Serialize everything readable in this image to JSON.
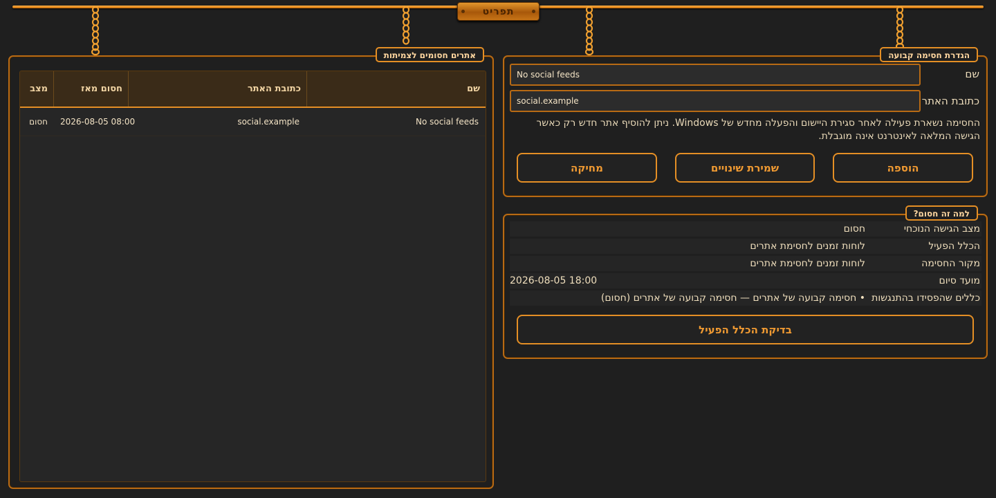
{
  "menu": {
    "label": "תפריט"
  },
  "blocked_list": {
    "title": "אתרים חסומים לצמיתות",
    "columns": {
      "name": "שם",
      "url": "כתובת האתר",
      "since": "חסום מאז",
      "status": "מצב"
    },
    "rows": [
      {
        "name": "No social feeds",
        "url": "social.example",
        "since": "2026-08-05 08:00",
        "status": "חסום"
      }
    ]
  },
  "form": {
    "title": "הגדרת חסימה קבועה",
    "name_label": "שם",
    "name_value": "No social feeds",
    "url_label": "כתובת האתר",
    "url_value": "social.example",
    "note": "החסימה נשארת פעילה לאחר סגירת היישום והפעלה מחדש של Windows. ניתן להוסיף אתר חדש רק כאשר הגישה המלאה לאינטרנט אינה מוגבלת.",
    "add_label": "הוספה",
    "save_label": "שמירת שינויים",
    "delete_label": "מחיקה"
  },
  "why": {
    "title": "?למה זה חסום",
    "access_state_label": "מצב הגישה הנוכחי",
    "access_state_value": "חסום",
    "active_rule_label": "הכלל הפעיל",
    "active_rule_value": "לוחות זמנים לחסימת אתרים",
    "block_source_label": "מקור החסימה",
    "block_source_value": "לוחות זמנים לחסימת אתרים",
    "end_time_label": "מועד סיום",
    "end_time_value": "2026-08-05 18:00",
    "lost_rules_label": "כללים שהפסידו בהתנגשות",
    "lost_rules_value": "• חסימה קבועה של אתרים — חסימה קבועה של אתרים (חסום)",
    "check_label": "בדיקת הכלל הפעיל"
  },
  "colors": {
    "accent": "#e58f25",
    "background": "#1f1f1f",
    "panel_border": "#b86a14"
  },
  "icons": [
    "chain-icon"
  ]
}
